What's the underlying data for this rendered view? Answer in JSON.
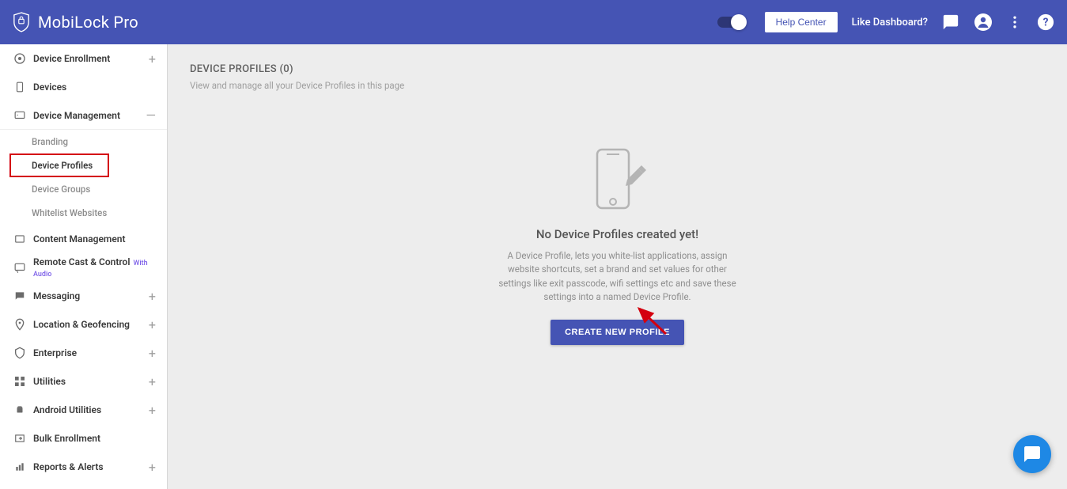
{
  "brand": "MobiLock Pro",
  "header": {
    "help_center": "Help Center",
    "like_dashboard": "Like Dashboard?"
  },
  "sidebar": {
    "items": [
      {
        "label": "Device Enrollment",
        "expand": "+"
      },
      {
        "label": "Devices",
        "expand": ""
      },
      {
        "label": "Device Management",
        "expand": "—"
      },
      {
        "label": "Content Management",
        "expand": ""
      },
      {
        "label": "Remote Cast & Control",
        "expand": "",
        "badge": "With Audio"
      },
      {
        "label": "Messaging",
        "expand": "+"
      },
      {
        "label": "Location & Geofencing",
        "expand": "+"
      },
      {
        "label": "Enterprise",
        "expand": "+"
      },
      {
        "label": "Utilities",
        "expand": "+"
      },
      {
        "label": "Android Utilities",
        "expand": "+"
      },
      {
        "label": "Bulk Enrollment",
        "expand": ""
      },
      {
        "label": "Reports & Alerts",
        "expand": "+"
      }
    ],
    "sub_items": [
      {
        "label": "Branding"
      },
      {
        "label": "Device Profiles"
      },
      {
        "label": "Device Groups"
      },
      {
        "label": "Whitelist Websites"
      }
    ]
  },
  "main": {
    "title": "DEVICE PROFILES (0)",
    "subtitle": "View and manage all your Device Profiles in this page",
    "empty_title": "No Device Profiles created yet!",
    "empty_desc": "A Device Profile, lets you white-list applications, assign website shortcuts, set a brand and set values for other settings like exit passcode, wifi settings etc and save these settings into a named Device Profile.",
    "create_button": "CREATE NEW PROFILE"
  }
}
